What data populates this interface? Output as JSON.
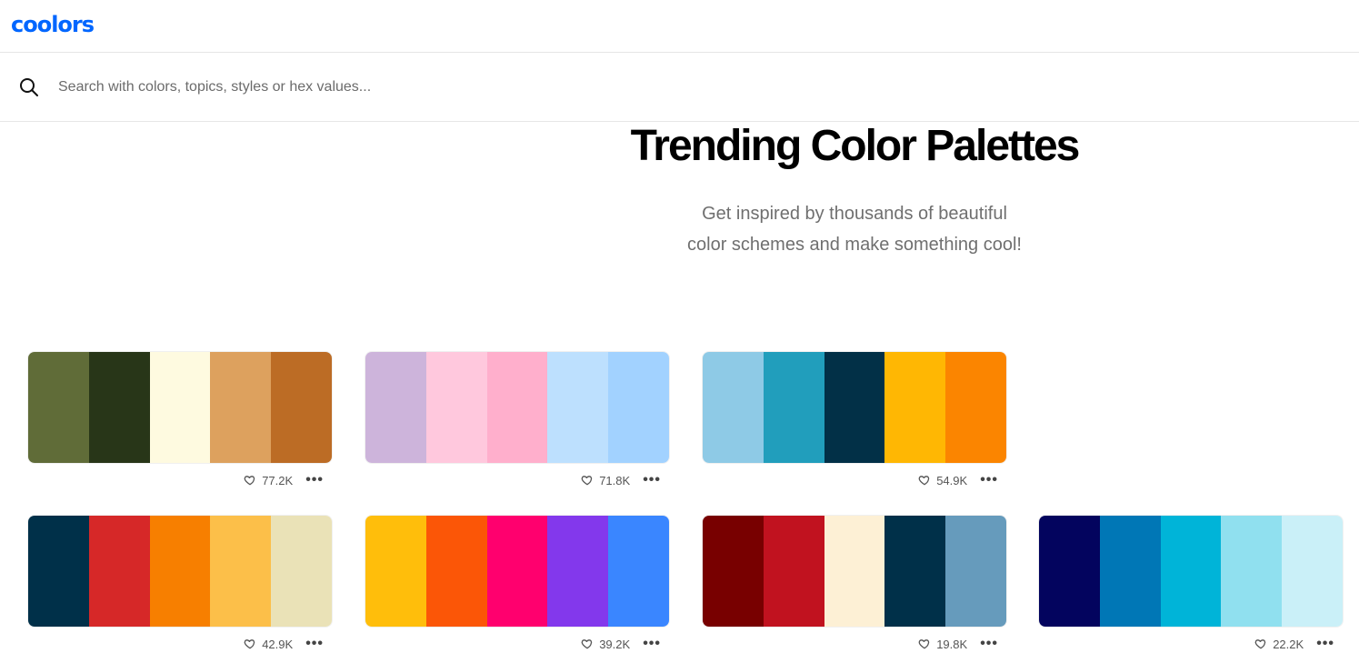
{
  "app": {
    "logo_text": "coolors",
    "brand_color": "#0066ff"
  },
  "search": {
    "placeholder": "Search with colors, topics, styles or hex values...",
    "icon": "search-icon"
  },
  "hero": {
    "title": "Trending Color Palettes",
    "subtitle_line1": "Get inspired by thousands of beautiful",
    "subtitle_line2": "color schemes and make something cool!"
  },
  "palettes": [
    {
      "colors": [
        "#606c38",
        "#283618",
        "#fefae0",
        "#dda15e",
        "#bc6c25"
      ],
      "likes": "77.2K"
    },
    {
      "colors": [
        "#cdb4db",
        "#ffc8dd",
        "#ffafcc",
        "#bde0fe",
        "#a2d2ff"
      ],
      "likes": "71.8K"
    },
    {
      "colors": [
        "#8ecae6",
        "#219ebc",
        "#023047",
        "#ffb703",
        "#fb8500"
      ],
      "likes": "54.9K"
    },
    {
      "colors": [
        "#003049",
        "#d62828",
        "#f77f00",
        "#fcbf49",
        "#eae2b7"
      ],
      "likes": "42.9K"
    },
    {
      "colors": [
        "#ffbe0b",
        "#fb5607",
        "#ff006e",
        "#8338ec",
        "#3a86ff"
      ],
      "likes": "39.2K"
    },
    {
      "colors": [
        "#780000",
        "#c1121f",
        "#fdf0d5",
        "#003049",
        "#669bbc"
      ],
      "likes": "19.8K"
    },
    {
      "colors": [
        "#03045e",
        "#0077b6",
        "#00b4d8",
        "#90e0ef",
        "#caf0f8"
      ],
      "likes": "22.2K"
    }
  ],
  "more_label": "•••"
}
